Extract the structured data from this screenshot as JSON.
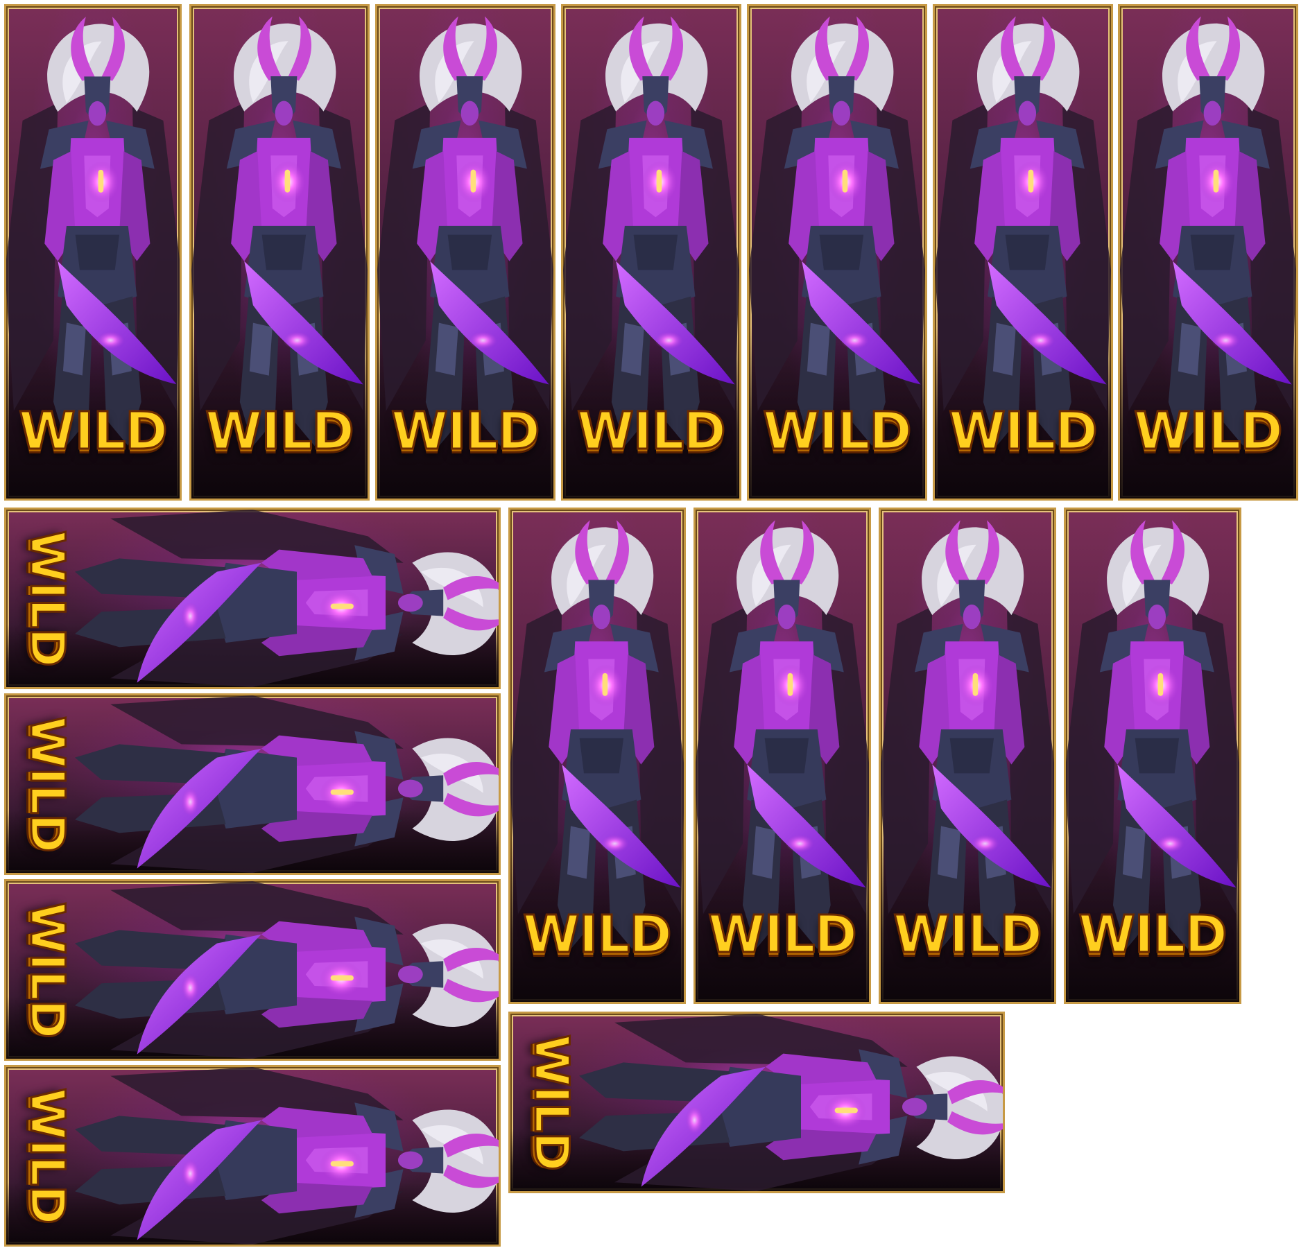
{
  "sheet": {
    "title": "",
    "wild_label": "WILD",
    "colors": {
      "frame_gold": "#c79a45",
      "wild_yellow": "#ffcf1f",
      "wild_outline": "#6a2a00",
      "demon_purple": "#b03ad8",
      "horn_magenta": "#c94bd6",
      "hair_silver": "#d7d4de",
      "armor_steel": "#3b3f63",
      "sky_crimson": "#7a2e57"
    },
    "tiles": [
      {
        "id": 1,
        "orientation": "vertical",
        "label": "WILD",
        "icon": "demon-warrior-icon"
      },
      {
        "id": 2,
        "orientation": "vertical",
        "label": "WILD",
        "icon": "demon-warrior-icon"
      },
      {
        "id": 3,
        "orientation": "vertical",
        "label": "WILD",
        "icon": "demon-warrior-icon"
      },
      {
        "id": 4,
        "orientation": "vertical",
        "label": "WILD",
        "icon": "demon-warrior-icon"
      },
      {
        "id": 5,
        "orientation": "vertical",
        "label": "WILD",
        "icon": "demon-warrior-icon"
      },
      {
        "id": 6,
        "orientation": "vertical",
        "label": "WILD",
        "icon": "demon-warrior-icon"
      },
      {
        "id": 7,
        "orientation": "vertical",
        "label": "WILD",
        "icon": "demon-warrior-icon"
      },
      {
        "id": 8,
        "orientation": "horizontal",
        "label": "WILD",
        "icon": "demon-warrior-icon"
      },
      {
        "id": 9,
        "orientation": "horizontal",
        "label": "WILD",
        "icon": "demon-warrior-icon"
      },
      {
        "id": 10,
        "orientation": "horizontal",
        "label": "WILD",
        "icon": "demon-warrior-icon"
      },
      {
        "id": 11,
        "orientation": "horizontal",
        "label": "WILD",
        "icon": "demon-warrior-icon"
      },
      {
        "id": 12,
        "orientation": "vertical",
        "label": "WILD",
        "icon": "demon-warrior-icon"
      },
      {
        "id": 13,
        "orientation": "vertical",
        "label": "WILD",
        "icon": "demon-warrior-icon"
      },
      {
        "id": 14,
        "orientation": "vertical",
        "label": "WILD",
        "icon": "demon-warrior-icon"
      },
      {
        "id": 15,
        "orientation": "vertical",
        "label": "WILD",
        "icon": "demon-warrior-icon"
      },
      {
        "id": 16,
        "orientation": "horizontal",
        "label": "WILD",
        "icon": "demon-warrior-icon"
      }
    ]
  }
}
